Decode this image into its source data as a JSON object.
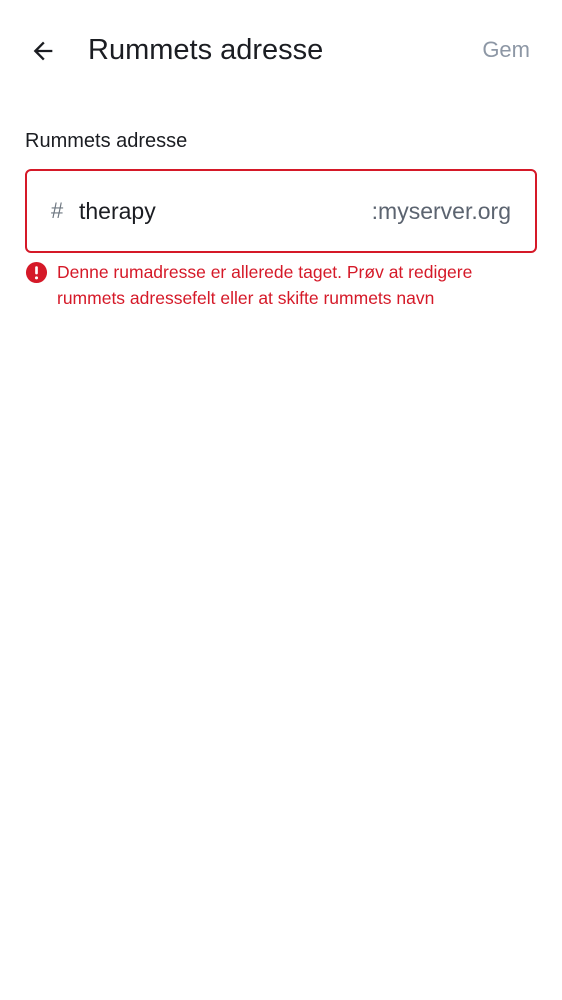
{
  "header": {
    "back_icon": "arrow-left-icon",
    "title": "Rummets adresse",
    "save_label": "Gem"
  },
  "address_field": {
    "label": "Rummets adresse",
    "prefix": "#",
    "value": "therapy",
    "suffix": ":myserver.org"
  },
  "error": {
    "icon": "error-icon",
    "message": "Denne rumadresse er allerede taget. Prøv at redigere rummets adressefelt eller at skifte rummets navn"
  },
  "colors": {
    "error": "#d51928",
    "disabled_action": "#8d97a5",
    "text": "#1b1d22"
  }
}
